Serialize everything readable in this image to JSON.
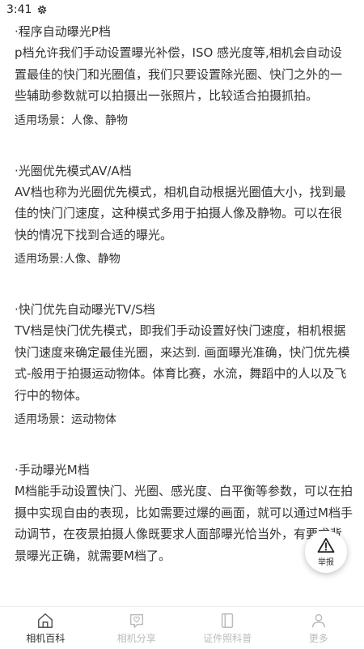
{
  "status_bar": {
    "time": "3:41",
    "settings_icon": "gear-icon"
  },
  "sections": [
    {
      "title": "·程序自动曝光P档",
      "body": "p档允许我们手动设置曝光补偿，ISO 感光度等,相机会自动设置最佳的快门和光圈值，我们只要设置除光圈、快门之外的一些辅助参数就可以拍摄出一张照片，比较适合拍摄抓拍。",
      "scene": "适用场景：人像、静物"
    },
    {
      "title": "·光圈优先模式AV/A档",
      "body": "AV档也称为光圈优先模式，相机自动根据光圈值大小，找到最佳的快门门速度，这种模式多用于拍摄人像及静物。可以在很快的情况下找到合适的曝光。",
      "scene": "适用场景:人像、静物"
    },
    {
      "title": "·快门优先自动曝光TV/S档",
      "body": "TV档是快门优先模式，即我们手动设置好快门速度，相机根据快门速度来确定最佳光圈，来达到. 画面曝光准确，快门优先模式-般用于拍摄运动物体。体育比赛，水流，舞蹈中的人以及飞行中的物体。",
      "scene": "适用场景：运动物体"
    },
    {
      "title": "·手动曝光M档",
      "body": "M档能手动设置快门、光圈、感光度、白平衡等参数，可以在拍摄中实现自由的表现，比如需要过爆的画面，就可以通过M档手动调节，在夜景拍摄人像既要求人面部曝光恰当外，有要求背景曝光正确，就需要M档了。",
      "scene": ""
    }
  ],
  "report_button": {
    "label": "举报",
    "icon": "warning-icon"
  },
  "tabs": [
    {
      "label": "相机百科",
      "icon": "home-icon",
      "active": true
    },
    {
      "label": "相机分享",
      "icon": "heart-chat-icon",
      "active": false
    },
    {
      "label": "证件照科普",
      "icon": "book-icon",
      "active": false
    },
    {
      "label": "更多",
      "icon": "user-icon",
      "active": false
    }
  ],
  "colors": {
    "active_tab": "#333333",
    "inactive_tab": "#bbbbbb",
    "text": "#333333"
  }
}
